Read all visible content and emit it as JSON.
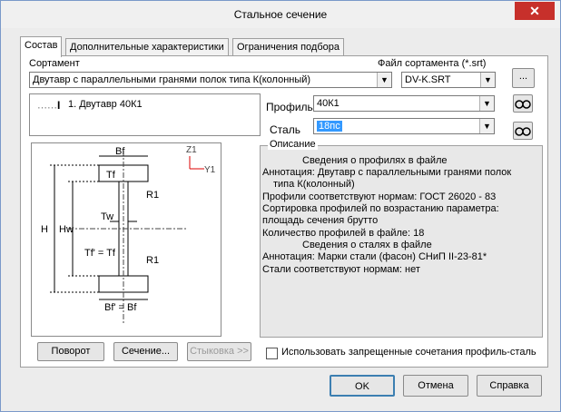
{
  "window": {
    "title": "Стальное сечение",
    "close_glyph": "✕"
  },
  "tabs": [
    {
      "label": "Состав"
    },
    {
      "label": "Дополнительные характеристики"
    },
    {
      "label": "Ограничения подбора"
    }
  ],
  "assortment": {
    "label": "Сортамент",
    "value": "Двутавр с параллельными гранями полок типа  К(колонный)",
    "file_label": "Файл сортамента (*.srt)",
    "file_value": "DV-K.SRT",
    "browse_label": "..."
  },
  "tree": {
    "item": "1. Двутавр 40К1",
    "icon_glyph": "I"
  },
  "profile": {
    "label": "Профиль",
    "value": "40К1"
  },
  "steel": {
    "label": "Сталь",
    "value": "18пс"
  },
  "description": {
    "title": "Описание",
    "lines": [
      "Сведения о профилях в файле",
      "Аннотация: Двутавр с параллельными гранями полок",
      "типа  К(колонный)",
      "Профили соответствуют нормам: ГОСТ 26020 - 83",
      "Сортировка профилей по возрастанию параметра:",
      "площадь сечения брутто",
      "Количество профилей в файле: 18",
      "Сведения о сталях в файле",
      "Аннотация: Марки  стали (фасон)  СНиП II-23-81*",
      "Стали соответствуют нормам: нет"
    ]
  },
  "drawing": {
    "labels": {
      "bf": "Bf",
      "tf": "Tf",
      "r1_top": "R1",
      "h": "H",
      "hw": "Hw",
      "tw": "Tw",
      "tf2": "Tf' = Tf",
      "r1_bot": "R1",
      "bf2": "Bf' = Bf",
      "z1": "Z1",
      "y1": "Y1"
    }
  },
  "buttons": {
    "rotate": "Поворот",
    "section": "Сечение...",
    "joint": "Стыковка >>",
    "forbidden_combo": "Использовать запрещенные сочетания профиль-сталь",
    "ok": "OK",
    "cancel": "Отмена",
    "help": "Справка"
  }
}
